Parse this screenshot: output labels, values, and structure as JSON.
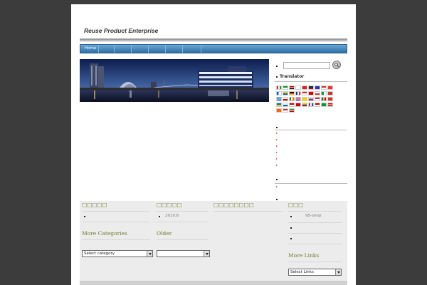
{
  "site": {
    "title": "Reuse Product Enterprise"
  },
  "nav": {
    "items": [
      {
        "label": "Home"
      },
      {
        "label": ""
      },
      {
        "label": ""
      },
      {
        "label": ""
      },
      {
        "label": ""
      },
      {
        "label": ""
      },
      {
        "label": ""
      }
    ]
  },
  "sidebar": {
    "search_placeholder": "",
    "translator_title": "Translator"
  },
  "footer": {
    "col1_title": "□□□□□",
    "col2_title": "□□□□□",
    "col2_item": "2010.6",
    "col3_title": "□□□□□□□□",
    "col4_title": "□□□",
    "col4_item": "95-shop",
    "more_categories_title": "More Categories",
    "select_category": "Select category",
    "older_title": "Older",
    "older_select": "",
    "more_links_title": "More Links",
    "select_links": "Select Links"
  },
  "colors": {
    "nav_top": "#6aa9d6",
    "nav_bottom": "#2f6fa6",
    "footer_heading": "#6f7f2f",
    "background": "#3c3c3c"
  }
}
